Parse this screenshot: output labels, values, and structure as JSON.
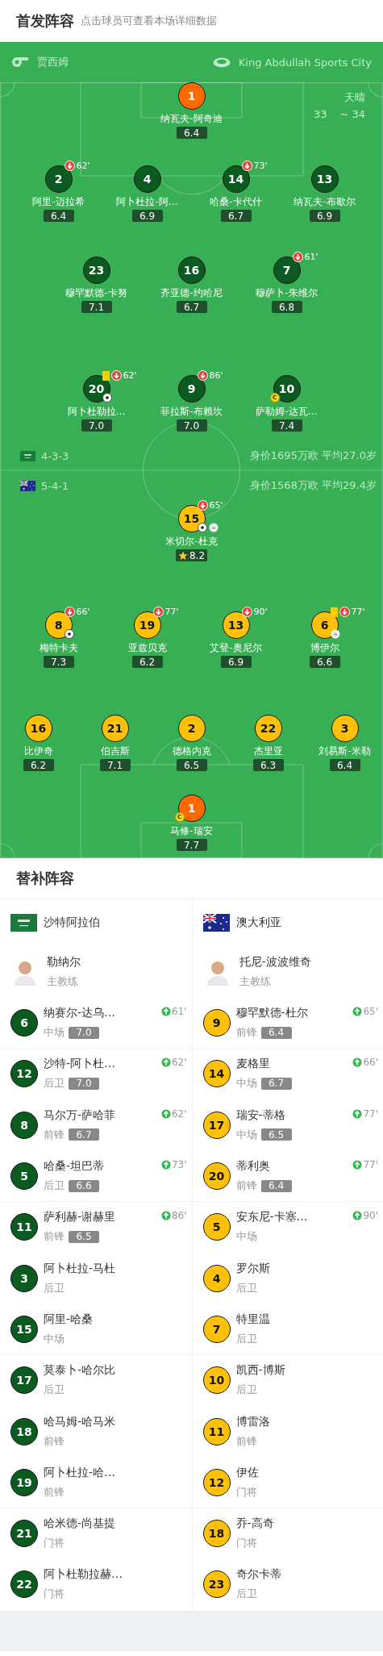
{
  "header": {
    "title": "首发阵容",
    "subtitle": "点击球员可查看本场详细数据"
  },
  "match_info": {
    "referee": "贾西姆",
    "stadium": "King Abdullah Sports City",
    "weather": "天晴",
    "temperature_low": "33",
    "temperature_high": "~ 34"
  },
  "teams": [
    {
      "kind": "saudi",
      "color": "#0b5a1f",
      "formation": "4-3-3",
      "summary": "身价1695万欧 平均27.0岁",
      "goalkeeper": {
        "number": "1",
        "name": "纳瓦夫-阿奇迪",
        "rating": "6.4"
      },
      "lines": [
        [
          {
            "number": "2",
            "name": "阿里-迈拉希",
            "rating": "6.4",
            "badges": [
              {
                "kind": "sub_off",
                "minute": "62'"
              }
            ]
          },
          {
            "number": "4",
            "name": "阿卜杜拉-阿…",
            "rating": "6.9"
          },
          {
            "number": "14",
            "name": "哈桑-卡代什",
            "rating": "6.7",
            "badges": [
              {
                "kind": "sub_off",
                "minute": "73'"
              }
            ]
          },
          {
            "number": "13",
            "name": "纳瓦夫-布歇尔",
            "rating": "6.9"
          }
        ],
        [
          {
            "number": "23",
            "name": "穆罕默德-卡努",
            "rating": "7.1"
          },
          {
            "number": "16",
            "name": "齐亚德-约哈尼",
            "rating": "6.7"
          },
          {
            "number": "7",
            "name": "穆萨卜-朱维尔",
            "rating": "6.8",
            "badges": [
              {
                "kind": "sub_off",
                "minute": "61'"
              }
            ]
          }
        ],
        [
          {
            "number": "20",
            "name": "阿卜杜勒拉…",
            "rating": "7.0",
            "badges": [
              {
                "kind": "yellow_card"
              },
              {
                "kind": "sub_off",
                "minute": "62'"
              },
              {
                "kind": "goal"
              }
            ]
          },
          {
            "number": "9",
            "name": "菲拉斯-布赖坎",
            "rating": "7.0",
            "badges": [
              {
                "kind": "sub_off",
                "minute": "86'"
              }
            ]
          },
          {
            "number": "10",
            "name": "萨勒姆-达瓦…",
            "rating": "7.4",
            "badges": [
              {
                "kind": "captain",
                "label": "C"
              }
            ]
          }
        ]
      ]
    },
    {
      "kind": "australia",
      "color": "#ffc107",
      "formation": "5-4-1",
      "summary": "身价1568万欧 平均29.4岁",
      "goalkeeper": {
        "number": "1",
        "name": "马修-瑞安",
        "rating": "7.7",
        "badges": [
          {
            "kind": "captain",
            "label": "C"
          }
        ]
      },
      "lines": [
        [
          {
            "number": "15",
            "name": "米切尔-杜克",
            "rating": "8.2",
            "badges": [
              {
                "kind": "sub_off",
                "minute": "65'"
              },
              {
                "kind": "goal"
              },
              {
                "kind": "assist"
              },
              {
                "kind": "best"
              }
            ]
          }
        ],
        [
          {
            "number": "8",
            "name": "梅特卡夫",
            "rating": "7.3",
            "badges": [
              {
                "kind": "sub_off",
                "minute": "66'"
              },
              {
                "kind": "goal"
              }
            ]
          },
          {
            "number": "19",
            "name": "亚兹贝克",
            "rating": "6.2",
            "badges": [
              {
                "kind": "sub_off",
                "minute": "77'"
              }
            ]
          },
          {
            "number": "13",
            "name": "艾登-奥尼尔",
            "rating": "6.9",
            "badges": [
              {
                "kind": "sub_off",
                "minute": "90'"
              }
            ]
          },
          {
            "number": "6",
            "name": "博伊尔",
            "rating": "6.6",
            "badges": [
              {
                "kind": "yellow_card"
              },
              {
                "kind": "sub_off",
                "minute": "77'"
              },
              {
                "kind": "assist"
              }
            ]
          }
        ],
        [
          {
            "number": "16",
            "name": "比伊奇",
            "rating": "6.2"
          },
          {
            "number": "21",
            "name": "伯吉斯",
            "rating": "7.1"
          },
          {
            "number": "2",
            "name": "德格内克",
            "rating": "6.5"
          },
          {
            "number": "22",
            "name": "杰里亚",
            "rating": "6.3"
          },
          {
            "number": "3",
            "name": "刘易斯-米勒",
            "rating": "6.4"
          }
        ]
      ]
    }
  ],
  "substitutes": {
    "title": "替补阵容",
    "teams": [
      {
        "kind": "saudi",
        "color": "#0b5a1f",
        "name": "沙特阿拉伯",
        "coach": {
          "name": "勒纳尔",
          "role": "主教练"
        },
        "players": [
          {
            "number": "6",
            "name": "纳赛尔-达乌…",
            "position": "中场",
            "rating": "7.0",
            "sub_on": "61'"
          },
          {
            "number": "12",
            "name": "沙特-阿卜杜…",
            "position": "后卫",
            "rating": "7.0",
            "sub_on": "62'"
          },
          {
            "number": "8",
            "name": "马尔万-萨哈菲",
            "position": "前锋",
            "rating": "6.7",
            "sub_on": "62'"
          },
          {
            "number": "5",
            "name": "哈桑-坦巴蒂",
            "position": "后卫",
            "rating": "6.6",
            "sub_on": "73'"
          },
          {
            "number": "11",
            "name": "萨利赫-谢赫里",
            "position": "前锋",
            "rating": "6.5",
            "sub_on": "86'"
          },
          {
            "number": "3",
            "name": "阿卜杜拉-马杜",
            "position": "后卫"
          },
          {
            "number": "15",
            "name": "阿里-哈桑",
            "position": "中场"
          },
          {
            "number": "17",
            "name": "莫泰卜-哈尔比",
            "position": "后卫"
          },
          {
            "number": "18",
            "name": "哈马姆-哈马米",
            "position": "前锋"
          },
          {
            "number": "19",
            "name": "阿卜杜拉-哈…",
            "position": "前锋"
          },
          {
            "number": "21",
            "name": "哈米德-尚基提",
            "position": "门将"
          },
          {
            "number": "22",
            "name": "阿卜杜勒拉赫…",
            "position": "门将"
          }
        ]
      },
      {
        "kind": "australia",
        "color": "#ffc107",
        "name": "澳大利亚",
        "coach": {
          "name": "托尼-波波维奇",
          "role": "主教练"
        },
        "players": [
          {
            "number": "9",
            "name": "穆罕默德-杜尔",
            "position": "前锋",
            "rating": "6.4",
            "sub_on": "65'"
          },
          {
            "number": "14",
            "name": "麦格里",
            "position": "中场",
            "rating": "6.7",
            "sub_on": "66'"
          },
          {
            "number": "17",
            "name": "瑞安-蒂格",
            "position": "中场",
            "rating": "6.5",
            "sub_on": "77'"
          },
          {
            "number": "20",
            "name": "蒂利奥",
            "position": "前锋",
            "rating": "6.4",
            "sub_on": "77'"
          },
          {
            "number": "5",
            "name": "安东尼-卡塞…",
            "position": "中场",
            "sub_on": "90'"
          },
          {
            "number": "4",
            "name": "罗尔斯",
            "position": "后卫"
          },
          {
            "number": "7",
            "name": "特里温",
            "position": "后卫"
          },
          {
            "number": "10",
            "name": "凯西-博斯",
            "position": "后卫"
          },
          {
            "number": "11",
            "name": "博雷洛",
            "position": "前锋"
          },
          {
            "number": "12",
            "name": "伊佐",
            "position": "门将"
          },
          {
            "number": "18",
            "name": "乔-高奇",
            "position": "门将"
          },
          {
            "number": "23",
            "name": "奇尔卡蒂",
            "position": "后卫"
          }
        ]
      }
    ]
  }
}
